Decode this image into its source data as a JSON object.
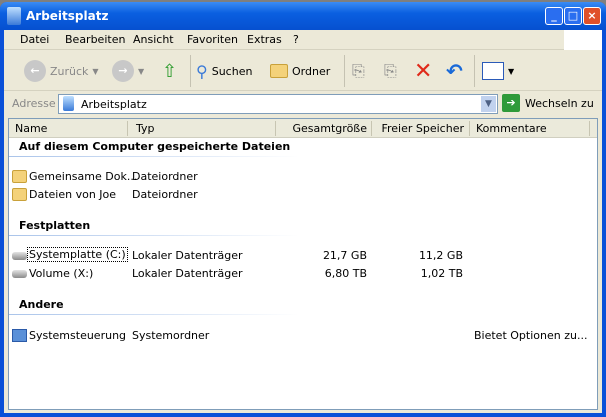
{
  "window": {
    "title": "Arbeitsplatz",
    "controls": [
      "_",
      "□",
      "×"
    ]
  },
  "menu": [
    "Datei",
    "Bearbeiten",
    "Ansicht",
    "Favoriten",
    "Extras",
    "?"
  ],
  "toolbar": {
    "back": "Zurück",
    "search": "Suchen",
    "folders": "Ordner"
  },
  "address": {
    "label": "Adresse",
    "value": "Arbeitsplatz",
    "go": "Wechseln zu"
  },
  "columns": [
    "Name",
    "Typ",
    "Gesamtgröße",
    "Freier Speicher",
    "Kommentare"
  ],
  "groups": [
    {
      "title": "Auf diesem Computer gespeicherte Dateien",
      "items": [
        {
          "name": "Gemeinsame Dok...",
          "type": "Dateiordner",
          "total": "",
          "free": "",
          "comment": "",
          "icon": "folder"
        },
        {
          "name": "Dateien von Joe",
          "type": "Dateiordner",
          "total": "",
          "free": "",
          "comment": "",
          "icon": "folder"
        }
      ]
    },
    {
      "title": "Festplatten",
      "items": [
        {
          "name": "Systemplatte (C:)",
          "type": "Lokaler Datenträger",
          "total": "21,7 GB",
          "free": "11,2 GB",
          "comment": "",
          "icon": "disk"
        },
        {
          "name": "Volume (X:)",
          "type": "Lokaler Datenträger",
          "total": "6,80 TB",
          "free": "1,02 TB",
          "comment": "",
          "icon": "disk"
        }
      ]
    },
    {
      "title": "Andere",
      "items": [
        {
          "name": "Systemsteuerung",
          "type": "Systemordner",
          "total": "",
          "free": "",
          "comment": "Bietet Optionen zu...",
          "icon": "control-panel"
        }
      ]
    }
  ]
}
